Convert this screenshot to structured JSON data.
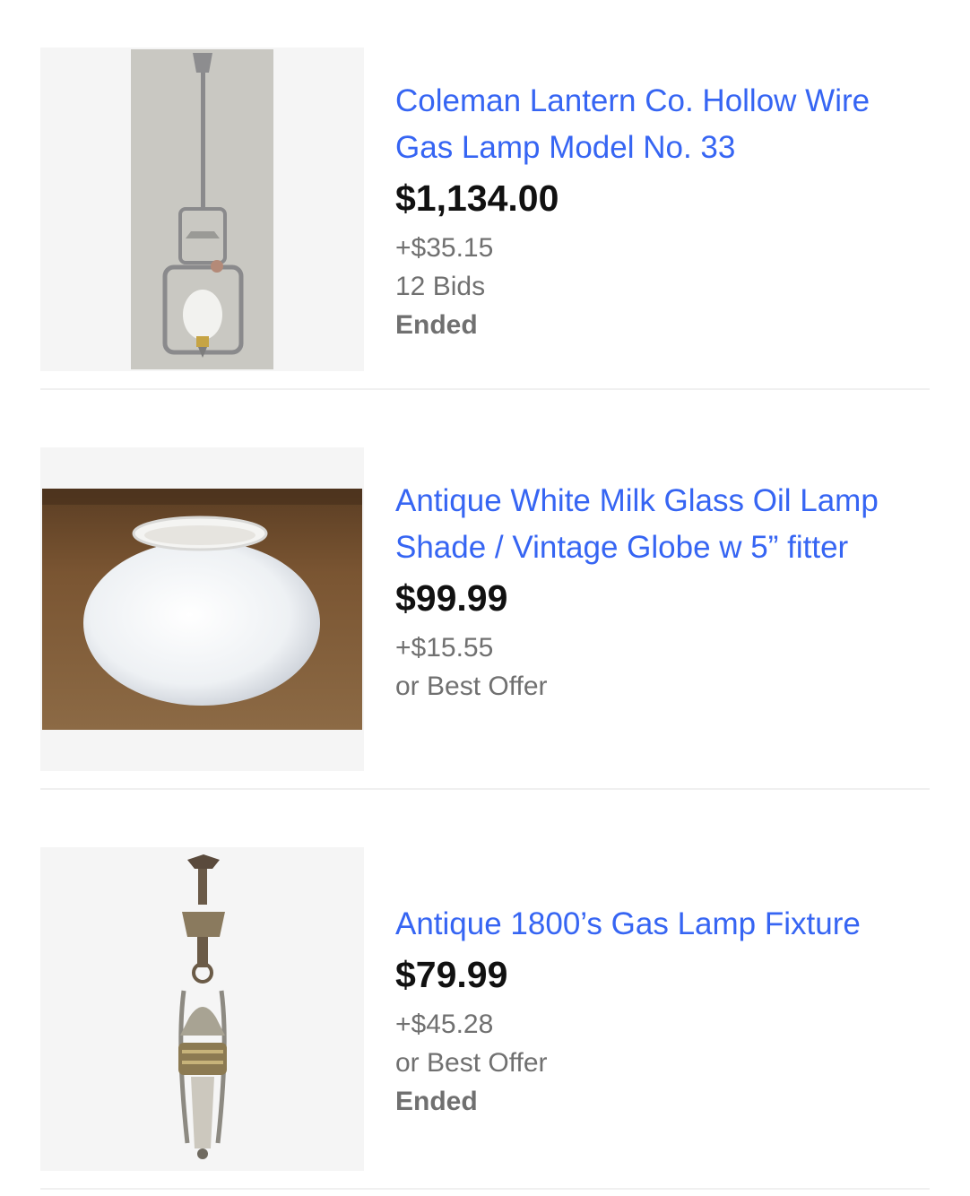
{
  "listings": [
    {
      "title": "Coleman Lantern Co. Hollow Wire Gas Lamp Model No. 33",
      "price": "$1,134.00",
      "shipping": "+$35.15",
      "bids": "12 Bids",
      "status": "Ended",
      "image": "gas-lamp-pendant-image"
    },
    {
      "title": "Antique White Milk Glass Oil Lamp Shade / Vintage Globe w 5” fitter",
      "price": "$99.99",
      "shipping": "+$15.55",
      "offer": "or Best Offer",
      "image": "milk-glass-shade-image"
    },
    {
      "title": "Antique 1800’s Gas Lamp Fixture",
      "price": "$79.99",
      "shipping": "+$45.28",
      "offer": "or Best Offer",
      "status": "Ended",
      "image": "gas-lamp-fixture-image"
    }
  ],
  "colors": {
    "link": "#3665f3",
    "price": "#111111",
    "meta": "#707070"
  }
}
